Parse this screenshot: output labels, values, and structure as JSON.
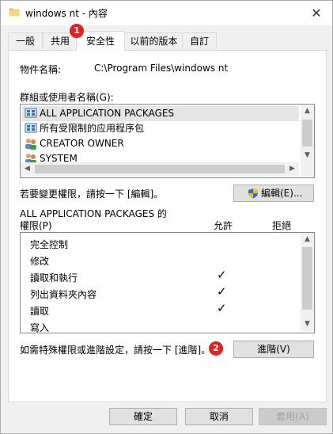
{
  "window": {
    "title": "windows nt - 內容",
    "close_glyph": "✕"
  },
  "tabs": [
    {
      "label": "一般"
    },
    {
      "label": "共用"
    },
    {
      "label": "安全性"
    },
    {
      "label": "以前的版本"
    },
    {
      "label": "自訂"
    }
  ],
  "security": {
    "object_name_label": "物件名稱:",
    "object_name_value": "C:\\Program Files\\windows nt",
    "groups_label": "群組或使用者名稱(G):",
    "groups": [
      {
        "name": "ALL APPLICATION PACKAGES",
        "icon": "app-packages-icon",
        "selected": true
      },
      {
        "name": "所有受限制的应用程序包",
        "icon": "app-packages-icon",
        "selected": false
      },
      {
        "name": "CREATOR OWNER",
        "icon": "users-icon",
        "selected": false
      },
      {
        "name": "SYSTEM",
        "icon": "users-icon",
        "selected": false
      }
    ],
    "edit_hint": "若要變更權限，請按一下 [編輯]。",
    "edit_button": "編輯(E)...",
    "perm_header_line1": "ALL APPLICATION PACKAGES 的",
    "perm_header_line2": "權限(P)",
    "allow_col": "允許",
    "deny_col": "拒絕",
    "permissions": [
      {
        "name": "完全控制",
        "allow": false,
        "deny": false
      },
      {
        "name": "修改",
        "allow": false,
        "deny": false
      },
      {
        "name": "讀取和執行",
        "allow": true,
        "deny": false
      },
      {
        "name": "列出資料夾內容",
        "allow": true,
        "deny": false
      },
      {
        "name": "讀取",
        "allow": true,
        "deny": false
      },
      {
        "name": "寫入",
        "allow": false,
        "deny": false
      }
    ],
    "check_glyph": "✓",
    "advanced_hint": "如需特殊權限或進階設定，請按一下 [進階]。",
    "advanced_button": "進階(V)"
  },
  "footer": {
    "ok": "確定",
    "cancel": "取消",
    "apply": "套用(A)"
  },
  "badges": {
    "first": "1",
    "second": "2"
  },
  "colors": {
    "badge": "#e3221f",
    "accent": "#0078d7",
    "selected_row": "#e5e5e5"
  }
}
